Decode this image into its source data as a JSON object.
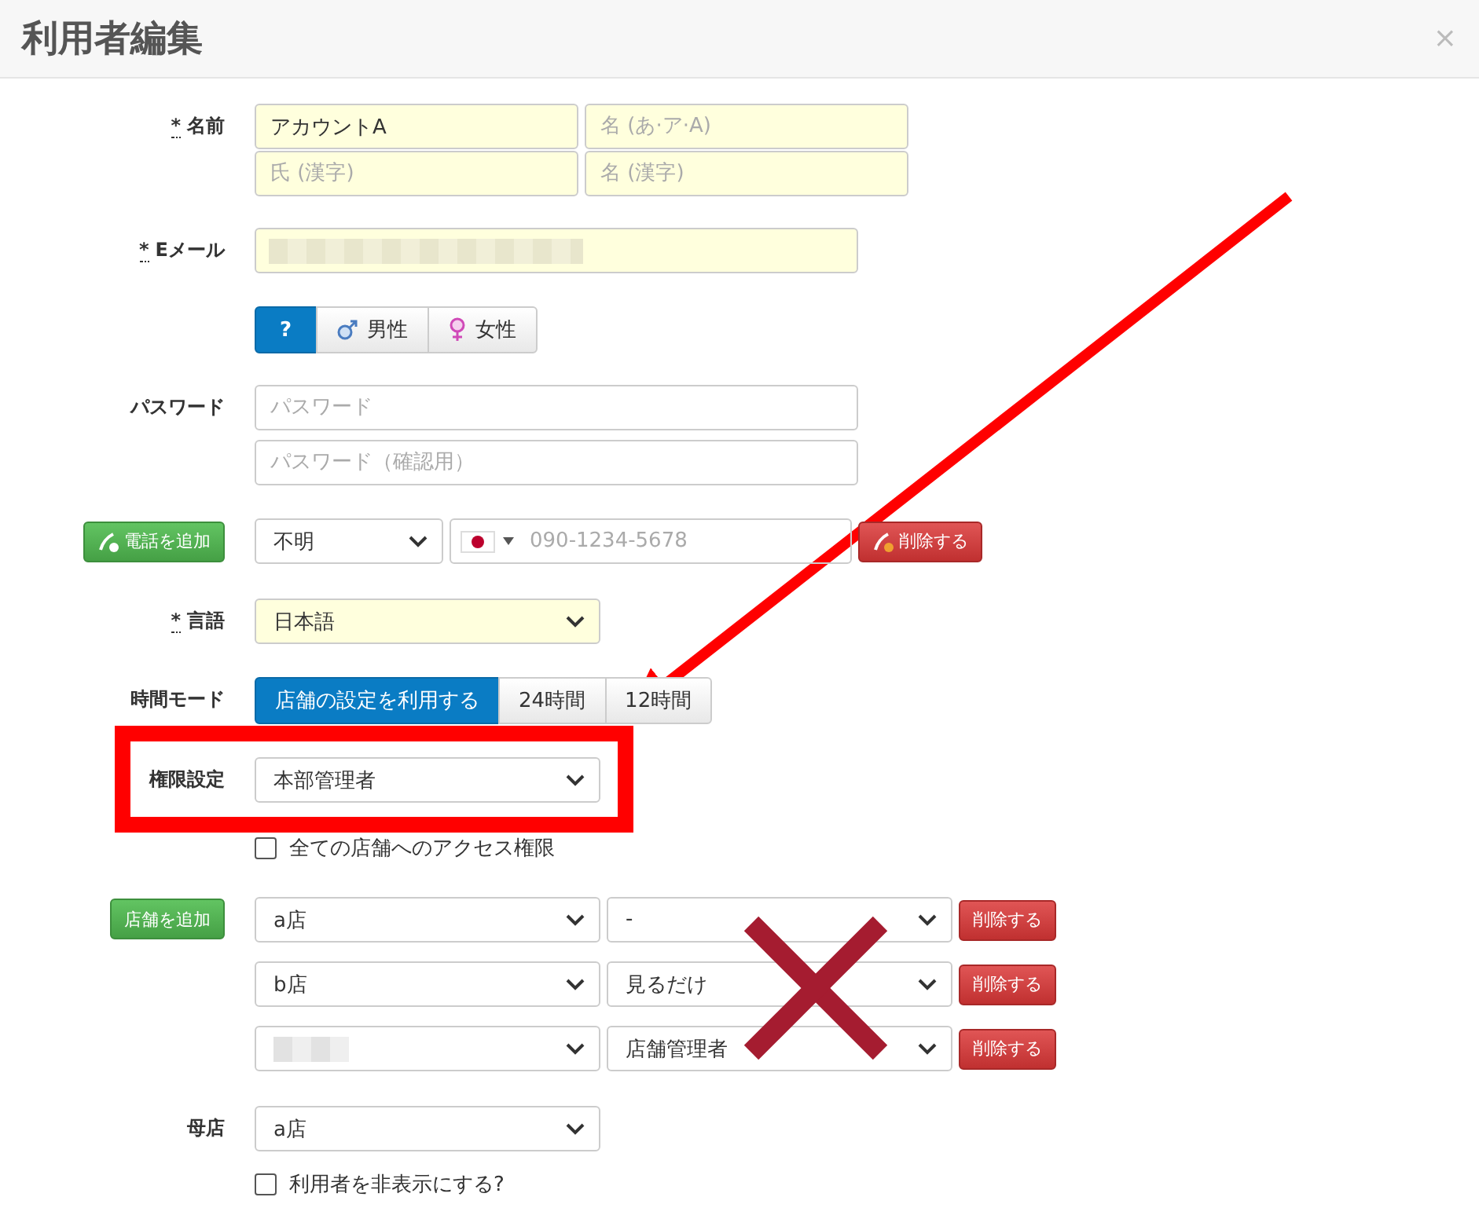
{
  "dialog": {
    "title": "利用者編集",
    "close": "×"
  },
  "name": {
    "mark": "*",
    "label": "名前",
    "inputs": [
      {
        "value": "アカウントA"
      },
      {
        "placeholder": "名 (あ·ア·A)"
      },
      {
        "placeholder": "氏 (漢字)"
      },
      {
        "placeholder": "名 (漢字)"
      }
    ]
  },
  "email": {
    "mark": "*",
    "label": "Eメール"
  },
  "gender": [
    {
      "label": "?",
      "kind": "unknown",
      "selected": true
    },
    {
      "label": "男性",
      "kind": "male",
      "selected": false
    },
    {
      "label": "女性",
      "kind": "female",
      "selected": false
    }
  ],
  "password": {
    "label": "パスワード",
    "inputs": [
      {
        "placeholder": "パスワード"
      },
      {
        "placeholder": "パスワード（確認用）"
      }
    ]
  },
  "phone": {
    "add_button": "電話を追加",
    "type": "不明",
    "placeholder": "090-1234-5678",
    "delete_button": "削除する"
  },
  "language": {
    "mark": "*",
    "label": "言語",
    "value": "日本語"
  },
  "time_mode": {
    "label": "時間モード",
    "options": [
      {
        "label": "店舗の設定を利用する",
        "selected": true
      },
      {
        "label": "24時間",
        "selected": false
      },
      {
        "label": "12時間",
        "selected": false
      }
    ]
  },
  "permission": {
    "label": "権限設定",
    "value": "本部管理者"
  },
  "all_stores_access": {
    "label": "全ての店舗へのアクセス権限",
    "checked": false
  },
  "stores": {
    "add_button": "店舗を追加",
    "rows": [
      {
        "store": "a店",
        "role": "-",
        "delete_button": "削除する"
      },
      {
        "store": "b店",
        "role": "見るだけ",
        "delete_button": "削除する"
      },
      {
        "store_blurred": true,
        "role": "店舗管理者",
        "delete_button": "削除する"
      }
    ]
  },
  "home_store": {
    "label": "母店",
    "value": "a店"
  },
  "hide_user": {
    "label": "利用者を非表示にする?",
    "checked": false
  }
}
